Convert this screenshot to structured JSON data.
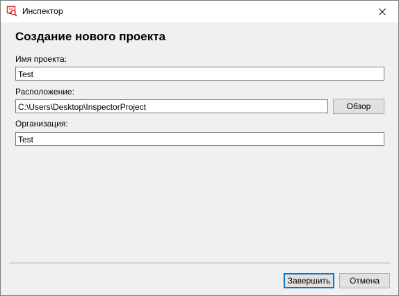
{
  "window": {
    "title": "Инспектор",
    "close_glyph": "✕"
  },
  "heading": "Создание нового проекта",
  "form": {
    "project_name_label": "Имя проекта:",
    "project_name_value": "Test",
    "location_label": "Расположение:",
    "location_value": "C:\\Users\\Desktop\\InspectorProject",
    "browse_label": "Обзор",
    "organization_label": "Организация:",
    "organization_value": "Test"
  },
  "footer": {
    "finish_label": "Завершить",
    "cancel_label": "Отмена"
  },
  "icons": {
    "app": "inspector-app-icon",
    "close": "close-icon"
  },
  "colors": {
    "accent": "#0078d7",
    "app_icon": "#d4242b"
  }
}
